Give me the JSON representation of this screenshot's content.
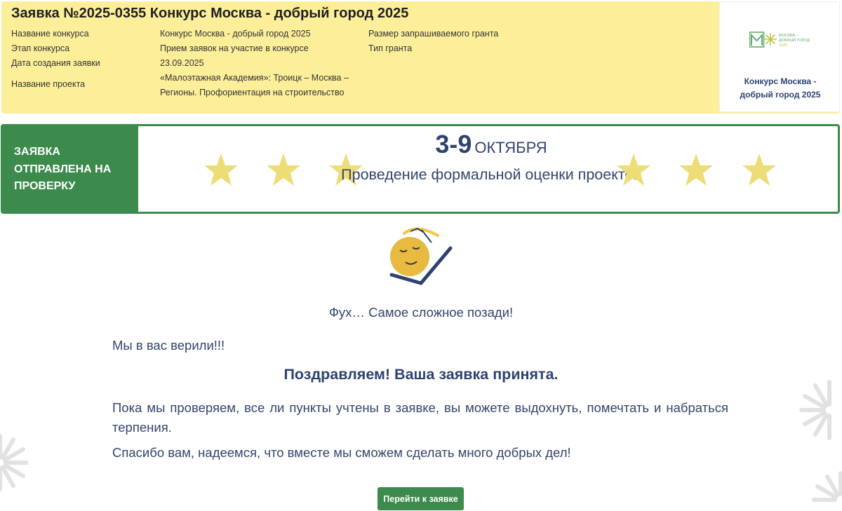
{
  "header": {
    "title": "Заявка №2025-0355 Конкурс Москва - добрый город 2025",
    "fields": {
      "contest_label": "Название конкурса",
      "contest_value": "Конкурс Москва - добрый город 2025",
      "stage_label": "Этап конкурса",
      "stage_value": "Прием заявок на участие в конкурсе",
      "created_label": "Дата создания заявки",
      "created_value": "23.09.2025",
      "project_label": "Название проекта",
      "project_value": "«Малоэтажная Академия»: Троицк – Москва – Регионы. Профориентация на строительство",
      "grant_size_label": "Размер запрашиваемого гранта",
      "grant_type_label": "Тип гранта"
    },
    "logo": {
      "text_line1": "МОСКВА –",
      "text_line2": "ДОБРЫЙ ГОРОД",
      "text_line3": "2025",
      "caption": "Конкурс Москва - добрый город 2025"
    }
  },
  "banner": {
    "status": "ЗАЯВКА ОТПРАВЛЕНА НА ПРОВЕРКУ",
    "date_range": "3-9",
    "date_month": "ОКТЯБРЯ",
    "stage": "Проведение формальной оценки проектов",
    "star_icon": "star-icon"
  },
  "main": {
    "mascot_icon": "relaxing-sun-icon",
    "relief_text": "Фух… Самое сложное позади!",
    "believed_text": "Мы в вас верили!!!",
    "congrats_text": "Поздравляем! Ваша заявка принята.",
    "paragraph1": "Пока мы проверяем, все ли пункты учтены в заявке, вы можете выдохнуть, помечтать и набраться терпения.",
    "paragraph2": "Спасибо вам, надеемся, что вместе мы сможем сделать много добрых дел!",
    "go_button_label": "Перейти к заявке"
  },
  "colors": {
    "header_bg": "#fdef9a",
    "accent_green": "#3c8a4c",
    "text_navy": "#2e4270",
    "star_yellow": "#eedd76"
  }
}
